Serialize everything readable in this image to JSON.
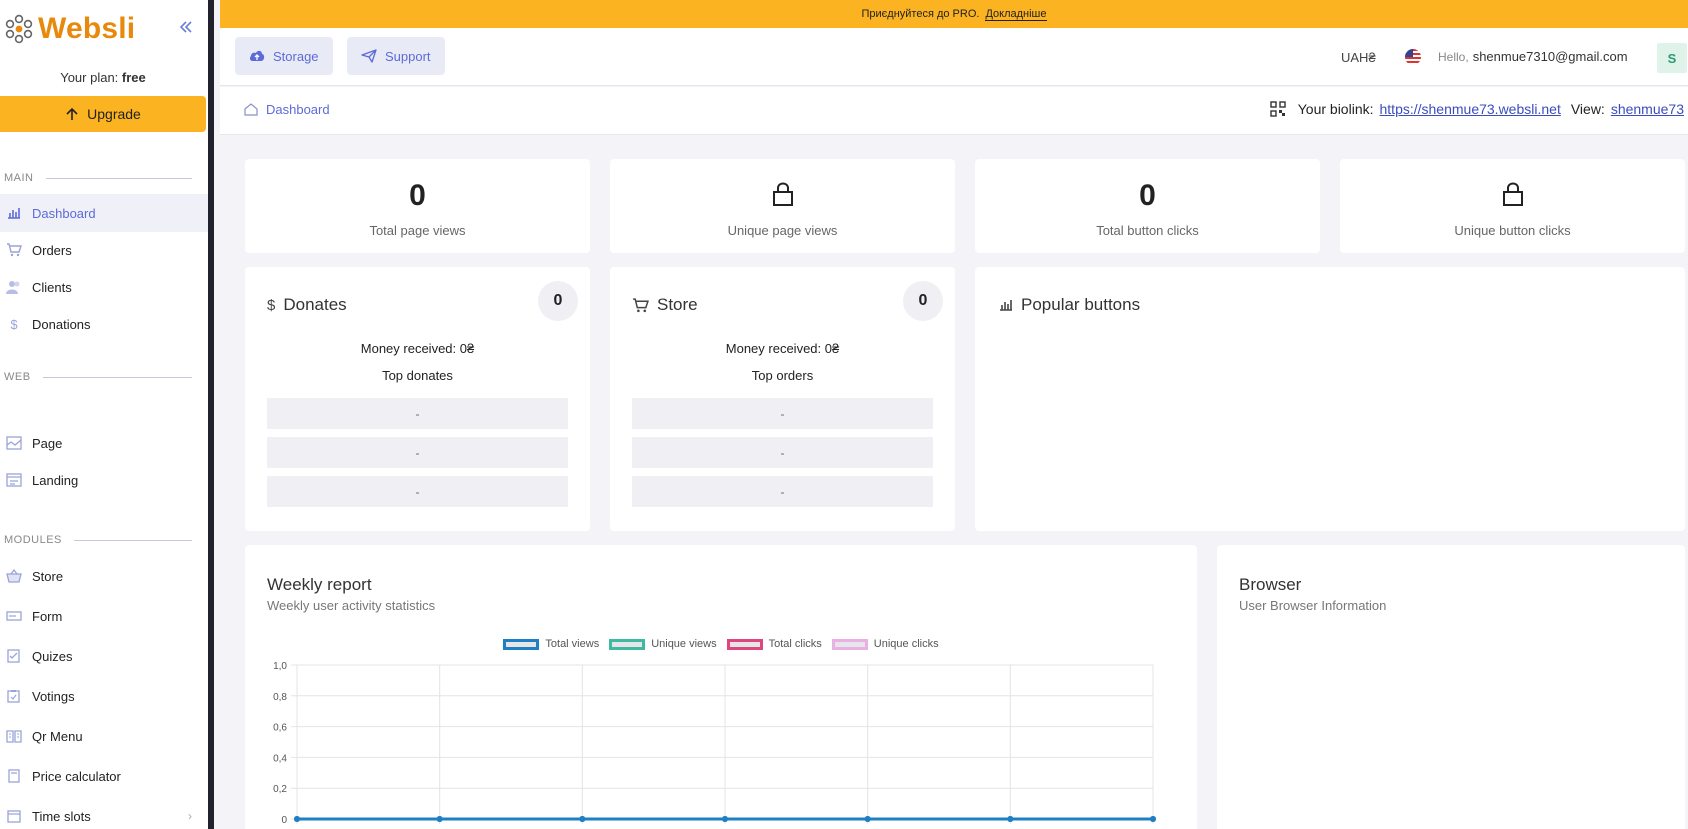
{
  "sidebar": {
    "logo": "Websli",
    "plan_label": "Your plan:",
    "plan_value": "free",
    "upgrade": "Upgrade",
    "sections": {
      "main": "MAIN",
      "web": "WEB",
      "modules": "MODULES"
    },
    "items": {
      "dashboard": "Dashboard",
      "orders": "Orders",
      "clients": "Clients",
      "donations": "Donations",
      "page": "Page",
      "landing": "Landing",
      "store": "Store",
      "form": "Form",
      "quizes": "Quizes",
      "votings": "Votings",
      "qr_menu": "Qr Menu",
      "price_calculator": "Price calculator",
      "time_slots": "Time slots"
    }
  },
  "banner": {
    "text": "Приєднуйтеся до PRO.",
    "link": "Докладніше"
  },
  "header": {
    "storage": "Storage",
    "support": "Support",
    "currency": "UAH₴",
    "hello": "Hello,",
    "email": "shenmue7310@gmail.com",
    "avatar_letter": "S"
  },
  "breadcrumb": {
    "dashboard": "Dashboard",
    "biolink_label": "Your biolink:",
    "biolink_url": "https://shenmue73.websli.net",
    "view_label": "View:",
    "view_link": "shenmue73"
  },
  "stats": {
    "total_page_views": {
      "value": "0",
      "label": "Total page views"
    },
    "unique_page_views": {
      "label": "Unique page views"
    },
    "total_button_clicks": {
      "value": "0",
      "label": "Total button clicks"
    },
    "unique_button_clicks": {
      "label": "Unique button clicks"
    }
  },
  "donates": {
    "title": "Donates",
    "count": "0",
    "money": "Money received: 0₴",
    "top_label": "Top donates",
    "rows": [
      "-",
      "-",
      "-"
    ]
  },
  "store": {
    "title": "Store",
    "count": "0",
    "money": "Money received: 0₴",
    "top_label": "Top orders",
    "rows": [
      "-",
      "-",
      "-"
    ]
  },
  "popular": {
    "title": "Popular buttons"
  },
  "weekly": {
    "title": "Weekly report",
    "subtitle": "Weekly user activity statistics"
  },
  "browser": {
    "title": "Browser",
    "subtitle": "User Browser Information"
  },
  "chart_data": {
    "type": "line",
    "title": "",
    "xlabel": "",
    "ylabel": "",
    "ylim": [
      0,
      1
    ],
    "y_ticks": [
      "0",
      "0,2",
      "0,4",
      "0,6",
      "0,8",
      "1,0"
    ],
    "x": [
      1,
      2,
      3,
      4,
      5,
      6,
      7
    ],
    "grid": true,
    "legend_position": "top",
    "series": [
      {
        "name": "Total views",
        "values": [
          0,
          0,
          0,
          0,
          0,
          0,
          0
        ],
        "color": "#1f7fc4"
      },
      {
        "name": "Unique views",
        "values": [
          0,
          0,
          0,
          0,
          0,
          0,
          0
        ],
        "color": "#3fb9a0"
      },
      {
        "name": "Total clicks",
        "values": [
          0,
          0,
          0,
          0,
          0,
          0,
          0
        ],
        "color": "#e0457b"
      },
      {
        "name": "Unique clicks",
        "values": [
          0,
          0,
          0,
          0,
          0,
          0,
          0
        ],
        "color": "#e9b0e4"
      }
    ]
  },
  "colors": {
    "accent": "#5c6bd8",
    "brand": "#fbb321",
    "logo": "#e8890c"
  }
}
